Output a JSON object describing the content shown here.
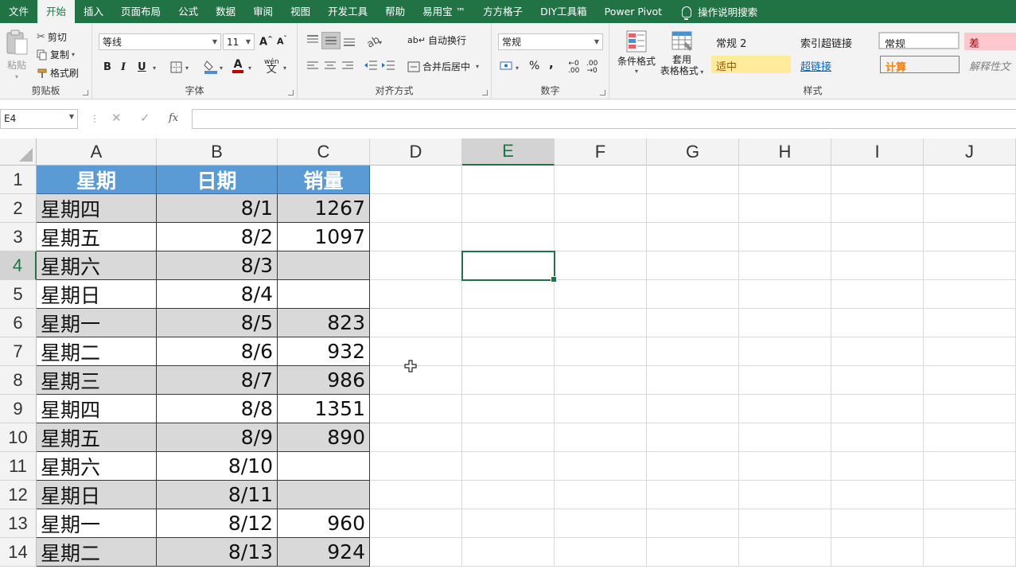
{
  "tabs": [
    "文件",
    "开始",
    "插入",
    "页面布局",
    "公式",
    "数据",
    "审阅",
    "视图",
    "开发工具",
    "帮助",
    "易用宝 ™",
    "方方格子",
    "DIY工具箱",
    "Power Pivot"
  ],
  "active_tab": "开始",
  "tell_me": "操作说明搜索",
  "clipboard": {
    "paste": "粘贴",
    "cut": "剪切",
    "copy": "复制",
    "format_painter": "格式刷",
    "label": "剪贴板"
  },
  "font": {
    "name": "等线",
    "size": "11",
    "grow": "A",
    "shrink": "A",
    "bold": "B",
    "italic": "I",
    "underline": "U",
    "phonetic": "wén",
    "label": "字体"
  },
  "alignment": {
    "wrap": "自动换行",
    "merge": "合并后居中",
    "label": "对齐方式"
  },
  "number": {
    "format": "常规",
    "percent": "%",
    "comma": ",",
    "label": "数字"
  },
  "styles": {
    "conditional": "条件格式",
    "table_line1": "套用",
    "table_line2": "表格格式",
    "normal2": "常规 2",
    "hyperlink_index": "索引超链接",
    "normal": "常规",
    "bad": "差",
    "neutral": "适中",
    "hyperlink": "超链接",
    "calc": "计算",
    "explanatory": "解释性文",
    "label": "样式"
  },
  "formula_bar": {
    "name_box": "E4",
    "cancel": "✕",
    "enter": "✓",
    "fx": "fx",
    "value": ""
  },
  "columns": [
    "A",
    "B",
    "C",
    "D",
    "E",
    "F",
    "G",
    "H",
    "I",
    "J"
  ],
  "selected_column": "E",
  "selected_row": "4",
  "rows": [
    "1",
    "2",
    "3",
    "4",
    "5",
    "6",
    "7",
    "8",
    "9",
    "10",
    "11",
    "12",
    "13",
    "14"
  ],
  "table_header": [
    "星期",
    "日期",
    "销量"
  ],
  "table_rows": [
    [
      "星期四",
      "8/1",
      "1267"
    ],
    [
      "星期五",
      "8/2",
      "1097"
    ],
    [
      "星期六",
      "8/3",
      ""
    ],
    [
      "星期日",
      "8/4",
      ""
    ],
    [
      "星期一",
      "8/5",
      "823"
    ],
    [
      "星期二",
      "8/6",
      "932"
    ],
    [
      "星期三",
      "8/7",
      "986"
    ],
    [
      "星期四",
      "8/8",
      "1351"
    ],
    [
      "星期五",
      "8/9",
      "890"
    ],
    [
      "星期六",
      "8/10",
      ""
    ],
    [
      "星期日",
      "8/11",
      ""
    ],
    [
      "星期一",
      "8/12",
      "960"
    ],
    [
      "星期二",
      "8/13",
      "924"
    ]
  ],
  "colors": {
    "accent": "#217346",
    "header_fill": "#5b9bd5",
    "band_fill": "#d9d9d9"
  }
}
